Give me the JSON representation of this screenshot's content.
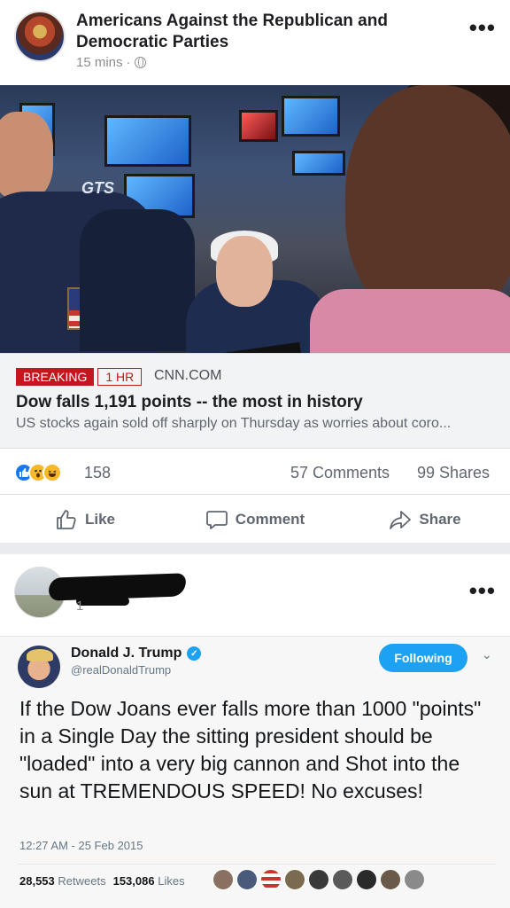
{
  "post1": {
    "page_name": "Americans Against the Republican and Democratic Parties",
    "timestamp": "15 mins",
    "separator": "·",
    "more": "•••",
    "image_text": "GTS",
    "link": {
      "badge": "BREAKING",
      "badge_time": "1 HR",
      "domain": "CNN.COM",
      "headline": "Dow falls 1,191 points -- the most in history",
      "description": "US stocks again sold off sharply on Thursday as worries about coro..."
    },
    "reactions": {
      "count": "158",
      "comments": "57 Comments",
      "shares": "99 Shares"
    },
    "actions": {
      "like": "Like",
      "comment": "Comment",
      "share": "Share"
    }
  },
  "post2": {
    "meta_fragment": "1",
    "more": "•••",
    "tweet": {
      "name": "Donald J. Trump",
      "handle": "@realDonaldTrump",
      "follow_label": "Following",
      "text": "If the Dow Joans ever falls more than 1000 \"points\" in a Single Day the sitting president should be \"loaded\" into a very big cannon and Shot into the sun at TREMENDOUS SPEED! No excuses!",
      "time": "12:27 AM - 25 Feb 2015",
      "retweets_count": "28,553",
      "retweets_label": "Retweets",
      "likes_count": "153,086",
      "likes_label": "Likes"
    }
  }
}
